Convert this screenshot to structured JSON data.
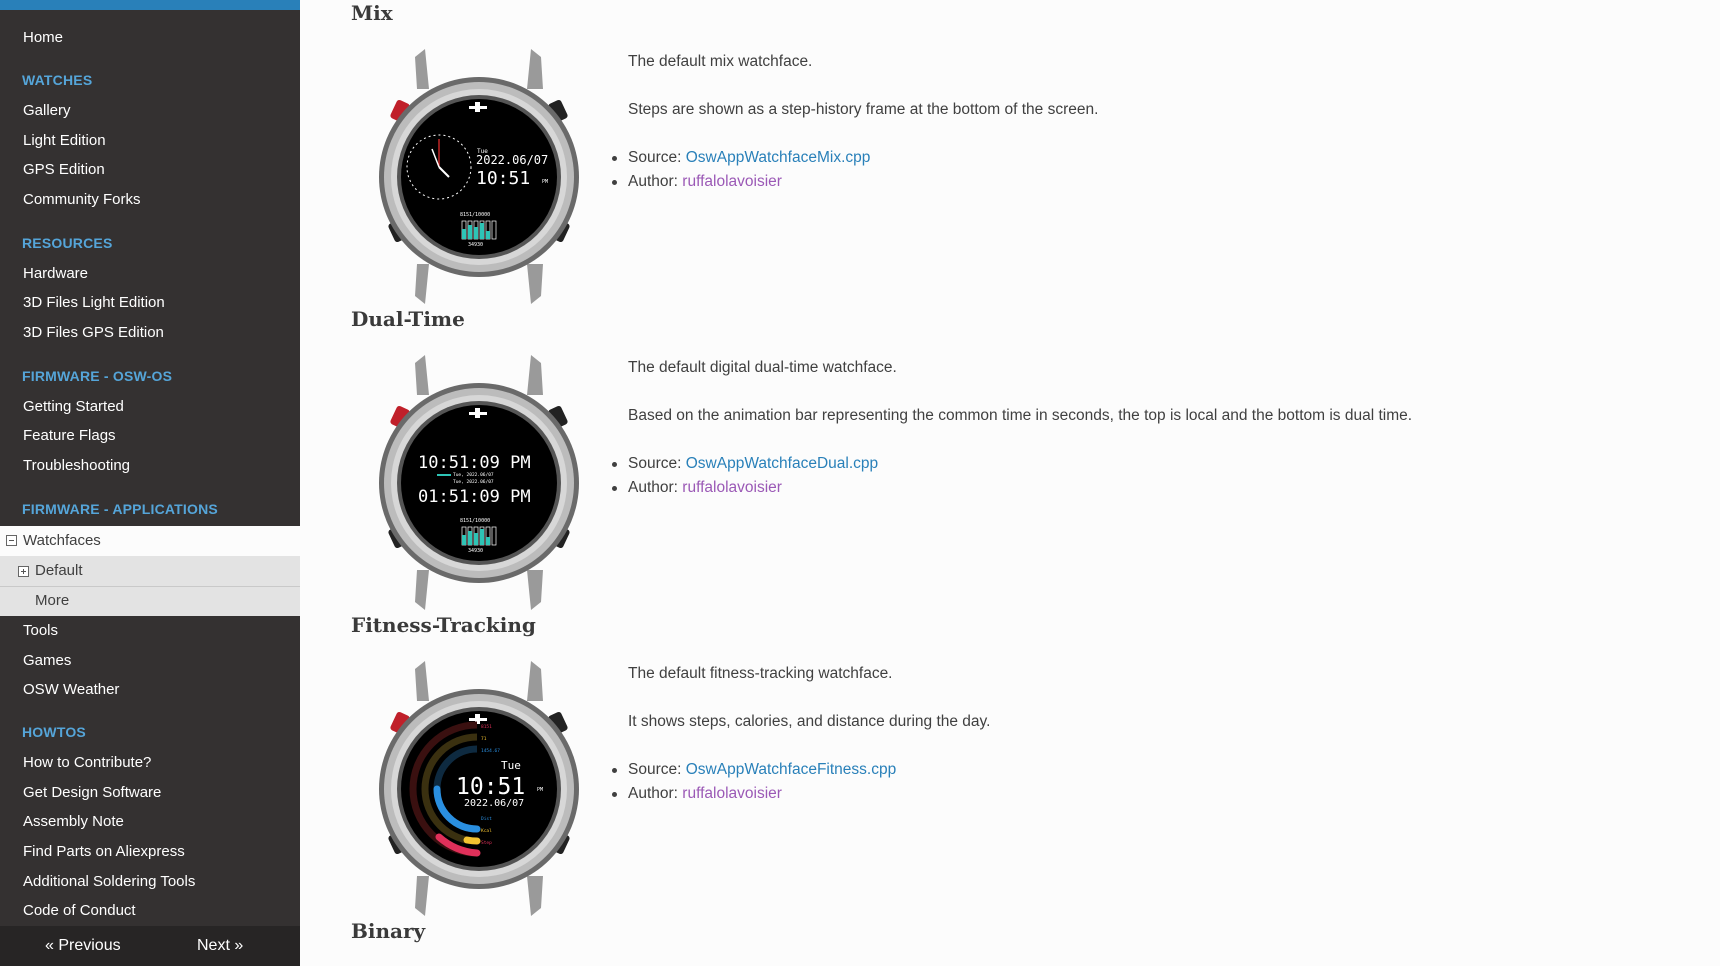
{
  "sidebar": {
    "home": "Home",
    "sections": [
      {
        "caption": "WATCHES",
        "items": [
          "Gallery",
          "Light Edition",
          "GPS Edition",
          "Community Forks"
        ]
      },
      {
        "caption": "RESOURCES",
        "items": [
          "Hardware",
          "3D Files Light Edition",
          "3D Files GPS Edition"
        ]
      },
      {
        "caption": "FIRMWARE - OSW-OS",
        "items": [
          "Getting Started",
          "Feature Flags",
          "Troubleshooting"
        ]
      },
      {
        "caption": "FIRMWARE - APPLICATIONS",
        "items": [
          "Watchfaces",
          "Tools",
          "Games",
          "OSW Weather"
        ]
      },
      {
        "caption": "HOWTOS",
        "items": [
          "How to Contribute?",
          "Get Design Software",
          "Assembly Note",
          "Find Parts on Aliexpress",
          "Additional Soldering Tools",
          "Code of Conduct"
        ]
      }
    ],
    "current": "Watchfaces",
    "sub_items": [
      "Default",
      "More"
    ],
    "prev": "« Previous",
    "next": "Next »"
  },
  "main": {
    "sections": [
      {
        "title": "Mix",
        "desc1": "The default mix watchface.",
        "desc2": "Steps are shown as a step-history frame at the bottom of the screen.",
        "source_label": "Source: ",
        "source_link": "OswAppWatchfaceMix.cpp",
        "author_label": "Author: ",
        "author_link": "ruffalolavoisier",
        "screen": {
          "day": "Tue",
          "date": "2022.06/07",
          "time": "10:51",
          "ampm": "PM",
          "steps_top": "8151/10000",
          "steps_bottom": "34930"
        }
      },
      {
        "title": "Dual-Time",
        "desc1": "The default digital dual-time watchface.",
        "desc2": "Based on the animation bar representing the common time in seconds, the top is local and the bottom is dual time.",
        "source_label": "Source: ",
        "source_link": "OswAppWatchfaceDual.cpp",
        "author_label": "Author: ",
        "author_link": "ruffalolavoisier",
        "screen": {
          "time1": "10:51:09 PM",
          "time2": "01:51:09 PM",
          "date1": "Tue, 2022.06/07",
          "date2": "Tue, 2022.06/07",
          "steps_top": "8151/10000",
          "steps_bottom": "34930"
        }
      },
      {
        "title": "Fitness-Tracking",
        "desc1": "The default fitness-tracking watchface.",
        "desc2": "It shows steps, calories, and distance during the day.",
        "source_label": "Source: ",
        "source_link": "OswAppWatchfaceFitness.cpp",
        "author_label": "Author: ",
        "author_link": "ruffalolavoisier",
        "screen": {
          "day": "Tue",
          "time": "10:51",
          "date": "2022.06/07",
          "ampm": "PM",
          "steps_value": "8151",
          "calories_value": "71",
          "distance_value": "1454.67",
          "dist_label": "Dist",
          "kcal_label": "Kcal",
          "step_label": "Step"
        }
      },
      {
        "title": "Binary"
      }
    ]
  },
  "colors": {
    "sidebar_bg": "#343131",
    "caption": "#55a5d9",
    "link": "#2980b9",
    "visited": "#9b59b6",
    "topbar": "#2980b9"
  }
}
